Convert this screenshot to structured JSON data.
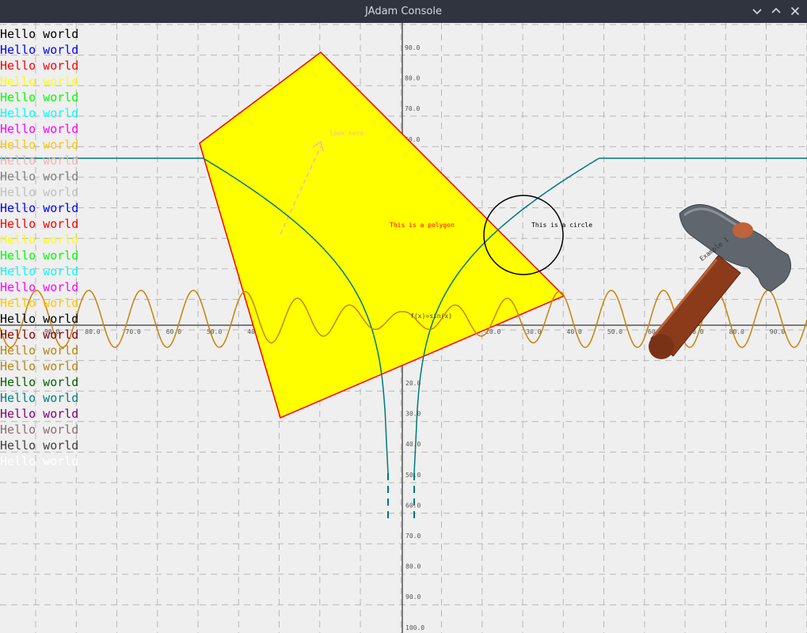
{
  "window": {
    "title": "JAdam Console",
    "controls": [
      "minimize",
      "maximize",
      "close"
    ]
  },
  "console": {
    "lines": [
      {
        "text": "Hello world",
        "color": "#000000"
      },
      {
        "text": "Hello world",
        "color": "#0000ff"
      },
      {
        "text": "Hello world",
        "color": "#ff0000"
      },
      {
        "text": "Hello world",
        "color": "#ffff00"
      },
      {
        "text": "Hello world",
        "color": "#00ff00"
      },
      {
        "text": "Hello world",
        "color": "#00ffff"
      },
      {
        "text": "Hello world",
        "color": "#ff00ff"
      },
      {
        "text": "Hello world",
        "color": "#ffc800"
      },
      {
        "text": "Hello world",
        "color": "#ffafaf"
      },
      {
        "text": "Hello world",
        "color": "#808080"
      },
      {
        "text": "Hello world",
        "color": "#c0c0c0"
      },
      {
        "text": "Hello world",
        "color": "#0000ff"
      },
      {
        "text": "Hello world",
        "color": "#ff0000"
      },
      {
        "text": "Hello world",
        "color": "#ffff00"
      },
      {
        "text": "Hello world",
        "color": "#00ff00"
      },
      {
        "text": "Hello world",
        "color": "#00ffff"
      },
      {
        "text": "Hello world",
        "color": "#ff00ff"
      },
      {
        "text": "Hello world",
        "color": "#ffc800"
      },
      {
        "text": "Hello world",
        "color": "#000000"
      },
      {
        "text": "Hello world",
        "color": "#8b0000"
      },
      {
        "text": "Hello world",
        "color": "#b8860b"
      },
      {
        "text": "Hello world",
        "color": "#b8860b"
      },
      {
        "text": "Hello world",
        "color": "#006400"
      },
      {
        "text": "Hello world",
        "color": "#008080"
      },
      {
        "text": "Hello world",
        "color": "#800080"
      },
      {
        "text": "Hello world",
        "color": "#8f6f6f"
      },
      {
        "text": "Hello world",
        "color": "#404040"
      },
      {
        "text": "Hello world",
        "color": "#ffffff"
      }
    ]
  },
  "plot": {
    "x_ticks_left": [
      "90.0",
      "80.0",
      "70.0",
      "60.0",
      "50.0",
      "40.0"
    ],
    "x_ticks_right": [
      "20.0",
      "30.0",
      "40.0",
      "50.0",
      "60.0",
      "70.0",
      "80.0",
      "90.0"
    ],
    "y_ticks_up": [
      "90.0",
      "80.0",
      "70.0",
      "60.0"
    ],
    "y_ticks_down": [
      "20.0",
      "30.0",
      "40.0",
      "50.0",
      "60.0",
      "70.0",
      "80.0",
      "90.0",
      "100.0"
    ],
    "polygon_label": "This is a polygon",
    "circle_label": "This is a circle",
    "arrow_label": "look here",
    "function_label": "f(x)=sin(x)",
    "image_label": "Example 1",
    "colors": {
      "background": "#efefef",
      "grid": "#b8b8b8",
      "axis": "#555555",
      "polygon_fill": "#ffff00",
      "polygon_stroke": "#ff0000",
      "sine": "#c8820a",
      "curve": "#007878",
      "arrow": "#ffafaf",
      "circle": "#000000"
    }
  }
}
